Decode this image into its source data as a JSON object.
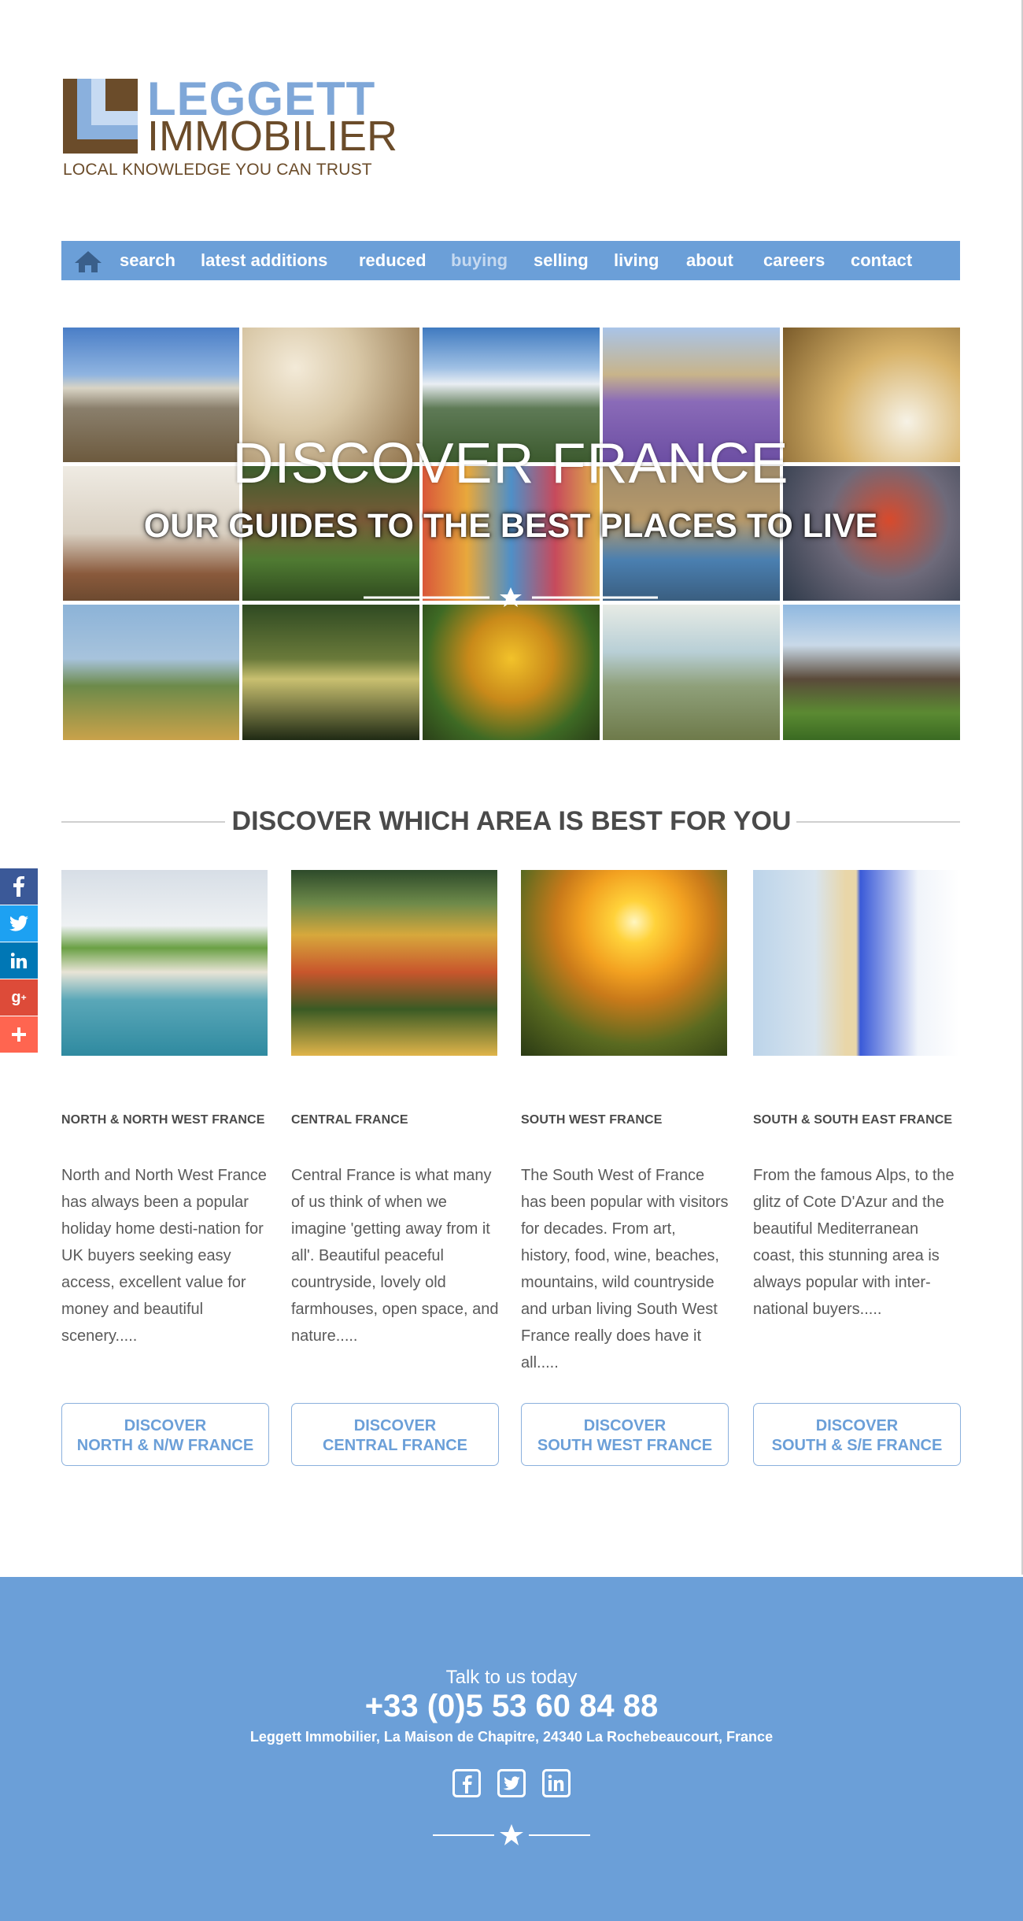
{
  "logo": {
    "line1": "LEGGETT",
    "line2": "IMMOBILIER",
    "tagline": "LOCAL KNOWLEDGE YOU CAN TRUST"
  },
  "nav": {
    "home_icon": "home-icon",
    "items": [
      {
        "label": "search"
      },
      {
        "label": "latest additions"
      },
      {
        "label": "reduced"
      },
      {
        "label": "buying"
      },
      {
        "label": "selling"
      },
      {
        "label": "living"
      },
      {
        "label": "about"
      },
      {
        "label": "careers"
      },
      {
        "label": "contact"
      }
    ],
    "active": "buying"
  },
  "hero": {
    "title": "DISCOVER FRANCE",
    "subtitle": "OUR GUIDES TO THE BEST PLACES TO LIVE"
  },
  "section": {
    "title": "DISCOVER WHICH AREA IS BEST FOR YOU"
  },
  "social": {
    "items": [
      "facebook-icon",
      "twitter-icon",
      "linkedin-icon",
      "google-plus-icon",
      "share-plus-icon"
    ]
  },
  "regions": [
    {
      "title": "NORTH & NORTH WEST FRANCE",
      "text": "North and North West France has always been a popular holiday home desti-nation for UK buyers seeking easy access, excellent value for money and beautiful scenery.....",
      "button_line1": "DISCOVER",
      "button_line2": "NORTH & N/W FRANCE"
    },
    {
      "title": "CENTRAL FRANCE",
      "text": "Central France is what many of us think of when we imagine 'getting away from it all'.  Beautiful peaceful countryside, lovely old farmhouses, open space, and nature.....",
      "button_line1": "DISCOVER",
      "button_line2": "CENTRAL FRANCE"
    },
    {
      "title": "SOUTH WEST FRANCE",
      "text": "The South West of France has been popular with visitors for decades. From art, history, food, wine, beaches, mountains, wild countryside and urban living South West France really does have it all.....",
      "button_line1": "DISCOVER",
      "button_line2": "SOUTH WEST FRANCE"
    },
    {
      "title": "SOUTH & SOUTH EAST FRANCE",
      "text": "From the famous Alps, to the glitz of Cote D'Azur and the beautiful Mediterranean coast, this stunning area is always popular with inter-national buyers.....",
      "button_line1": "DISCOVER",
      "button_line2": "SOUTH & S/E FRANCE"
    }
  ],
  "footer": {
    "talk": "Talk to us today",
    "phone": "+33 (0)5 53 60 84 88",
    "address": "Leggett Immobilier, La Maison de Chapitre, 24340 La Rochebeaucourt, France",
    "icons": [
      "facebook-icon",
      "twitter-icon",
      "linkedin-icon"
    ]
  },
  "colors": {
    "brand_blue": "#6b9fd8",
    "brand_brown": "#6b4c2a",
    "light_blue": "#8ab0dd",
    "facebook": "#3b5998",
    "twitter": "#1da1f2",
    "linkedin": "#0077b5",
    "google_plus": "#dd4b39",
    "share": "#ff6550"
  }
}
